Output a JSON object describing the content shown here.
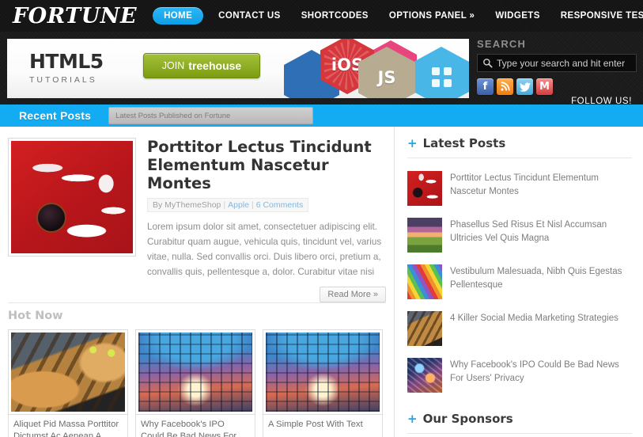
{
  "site": {
    "logo": "FORTUNE",
    "nav": [
      {
        "label": "HOME",
        "active": true
      },
      {
        "label": "CONTACT US",
        "active": false
      },
      {
        "label": "SHORTCODES",
        "active": false
      },
      {
        "label": "OPTIONS PANEL »",
        "active": false
      },
      {
        "label": "WIDGETS",
        "active": false
      },
      {
        "label": "RESPONSIVE TEST",
        "active": false
      }
    ]
  },
  "banner": {
    "headline": "HTML5",
    "subhead": "TUTORIALS",
    "cta_join": "JOIN",
    "cta_brand": "treehouse",
    "badge_ios": "iOS",
    "badge_js": "JS"
  },
  "search": {
    "label": "SEARCH",
    "placeholder": "Type your search and hit enter",
    "value": "",
    "icon": "search-icon"
  },
  "social": {
    "follow_label": "FOLLOW US!",
    "items": [
      {
        "name": "facebook-icon",
        "glyph": "f",
        "color": "#3b5fa8"
      },
      {
        "name": "rss-icon",
        "glyph": "◔",
        "color": "#ef7c11"
      },
      {
        "name": "twitter-icon",
        "glyph": "ᴠ",
        "color": "#41a9dd"
      },
      {
        "name": "gmail-icon",
        "glyph": "M",
        "color": "#d63c3c"
      }
    ]
  },
  "bluebar": {
    "tab": "Recent Posts",
    "subtitle": "Latest Posts Published on Fortune",
    "color": "#13abf2"
  },
  "feature": {
    "title": "Porttitor Lectus Tincidunt Elementum Nascetur Montes",
    "meta_by": "By MyThemeShop",
    "meta_category": "Apple",
    "meta_comments": "6 Comments",
    "excerpt": "Lorem ipsum dolor sit amet, consectetuer adipiscing elit. Curabitur quam augue, vehicula quis, tincidunt vel, varius vitae, nulla. Sed convallis orci. Duis libero orci, pretium a, convallis quis, pellentesque a, dolor. Curabitur vitae nisi",
    "read_more": "Read More »",
    "thumb": "red-flower-photo"
  },
  "hotnow": {
    "title": "Hot Now",
    "cards": [
      {
        "caption": "Aliquet Pid Massa Porttitor Dictumst Ac Aenean A",
        "image": "cat-photo"
      },
      {
        "caption": "Why Facebook's IPO Could Be Bad News For Users'",
        "image": "arcade-photo"
      },
      {
        "caption": "A Simple Post With Text",
        "image": "arcade-photo"
      }
    ]
  },
  "sidebar": {
    "latest_posts": {
      "title": "Latest Posts",
      "items": [
        {
          "title": "Porttitor Lectus Tincidunt Elementum Nascetur Montes",
          "thumb": "flower"
        },
        {
          "title": "Phasellus Sed Risus Et Nisl Accumsan Ultricies Vel Quis Magna",
          "thumb": "sunset"
        },
        {
          "title": "Vestibulum Malesuada, Nibh Quis Egestas Pellentesque",
          "thumb": "pencils"
        },
        {
          "title": "4 Killer Social Media Marketing Strategies",
          "thumb": "cat"
        },
        {
          "title": "Why Facebook's IPO Could Be Bad News For Users' Privacy",
          "thumb": "facebook"
        }
      ]
    },
    "sponsors": {
      "title": "Our Sponsors"
    }
  },
  "accent": "#16a9f0"
}
